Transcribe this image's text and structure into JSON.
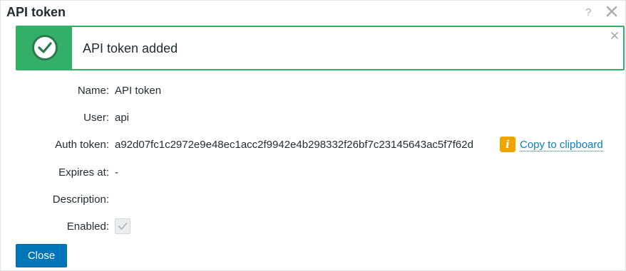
{
  "dialog": {
    "title": "API token",
    "help_label": "?"
  },
  "message": {
    "text": "API token added",
    "status_color": "#34af67"
  },
  "form": {
    "name": {
      "label": "Name:",
      "value": "API token"
    },
    "user": {
      "label": "User:",
      "value": "api"
    },
    "auth_token": {
      "label": "Auth token:",
      "value": "a92d07fc1c2972e9e48ec1acc2f9942e4b298332f26bf7c23145643ac5f7f62d",
      "info_icon": "i",
      "copy_label": "Copy to clipboard"
    },
    "expires_at": {
      "label": "Expires at:",
      "value": "-"
    },
    "description": {
      "label": "Description:",
      "value": ""
    },
    "enabled": {
      "label": "Enabled:",
      "checked": true
    }
  },
  "footer": {
    "close_label": "Close",
    "accent_color": "#0275b8"
  }
}
